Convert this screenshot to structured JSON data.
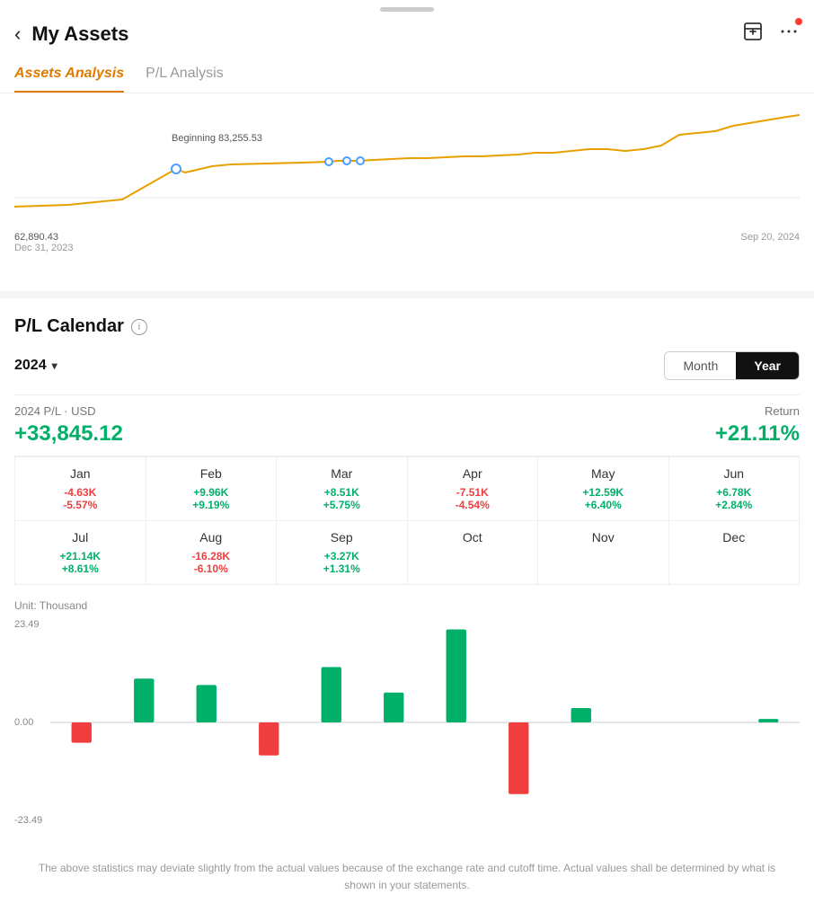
{
  "app": {
    "drag_handle": true
  },
  "header": {
    "title": "My Assets",
    "back_label": "‹",
    "share_icon": "⬜",
    "more_icon": "•••"
  },
  "tabs": [
    {
      "id": "assets",
      "label": "Assets Analysis",
      "active": true
    },
    {
      "id": "pl",
      "label": "P/L Analysis",
      "active": false
    }
  ],
  "chart": {
    "start_value": "62,890.43",
    "start_date": "Dec 31, 2023",
    "end_date": "Sep 20, 2024",
    "beginning_label": "Beginning 83,255.53"
  },
  "pl_calendar": {
    "title": "P/L Calendar",
    "year": "2024",
    "view_toggle": {
      "month_label": "Month",
      "year_label": "Year",
      "active": "Year"
    },
    "summary": {
      "label": "2024 P/L · USD",
      "value": "+33,845.12",
      "return_label": "Return",
      "return_value": "+21.11%"
    },
    "months": [
      {
        "name": "Jan",
        "pl": "-4.63K",
        "pct": "-5.57%",
        "sign": "neg"
      },
      {
        "name": "Feb",
        "pl": "+9.96K",
        "pct": "+9.19%",
        "sign": "pos"
      },
      {
        "name": "Mar",
        "pl": "+8.51K",
        "pct": "+5.75%",
        "sign": "pos"
      },
      {
        "name": "Apr",
        "pl": "-7.51K",
        "pct": "-4.54%",
        "sign": "neg"
      },
      {
        "name": "May",
        "pl": "+12.59K",
        "pct": "+6.40%",
        "sign": "pos"
      },
      {
        "name": "Jun",
        "pl": "+6.78K",
        "pct": "+2.84%",
        "sign": "pos"
      },
      {
        "name": "Jul",
        "pl": "+21.14K",
        "pct": "+8.61%",
        "sign": "pos"
      },
      {
        "name": "Aug",
        "pl": "-16.28K",
        "pct": "-6.10%",
        "sign": "neg"
      },
      {
        "name": "Sep",
        "pl": "+3.27K",
        "pct": "+1.31%",
        "sign": "pos"
      },
      {
        "name": "Oct",
        "pl": "",
        "pct": "",
        "sign": "empty"
      },
      {
        "name": "Nov",
        "pl": "",
        "pct": "",
        "sign": "empty"
      },
      {
        "name": "Dec",
        "pl": "",
        "pct": "",
        "sign": "empty"
      }
    ],
    "bar_chart": {
      "unit_label": "Unit: Thousand",
      "y_max": "23.49",
      "y_zero": "0.00",
      "y_min": "-23.49",
      "bars": [
        {
          "month": "Jan",
          "value": -4.63
        },
        {
          "month": "Feb",
          "value": 9.96
        },
        {
          "month": "Mar",
          "value": 8.51
        },
        {
          "month": "Apr",
          "value": -7.51
        },
        {
          "month": "May",
          "value": 12.59
        },
        {
          "month": "Jun",
          "value": 6.78
        },
        {
          "month": "Jul",
          "value": 21.14
        },
        {
          "month": "Aug",
          "value": -16.28
        },
        {
          "month": "Sep",
          "value": 3.27
        },
        {
          "month": "Oct",
          "value": 0
        },
        {
          "month": "Nov",
          "value": 0
        },
        {
          "month": "Dec",
          "value": 0.8
        }
      ]
    }
  },
  "disclaimer": "The above statistics may deviate slightly from the actual values because of the exchange rate and cutoff time. Actual values shall be determined by what is shown in your statements."
}
